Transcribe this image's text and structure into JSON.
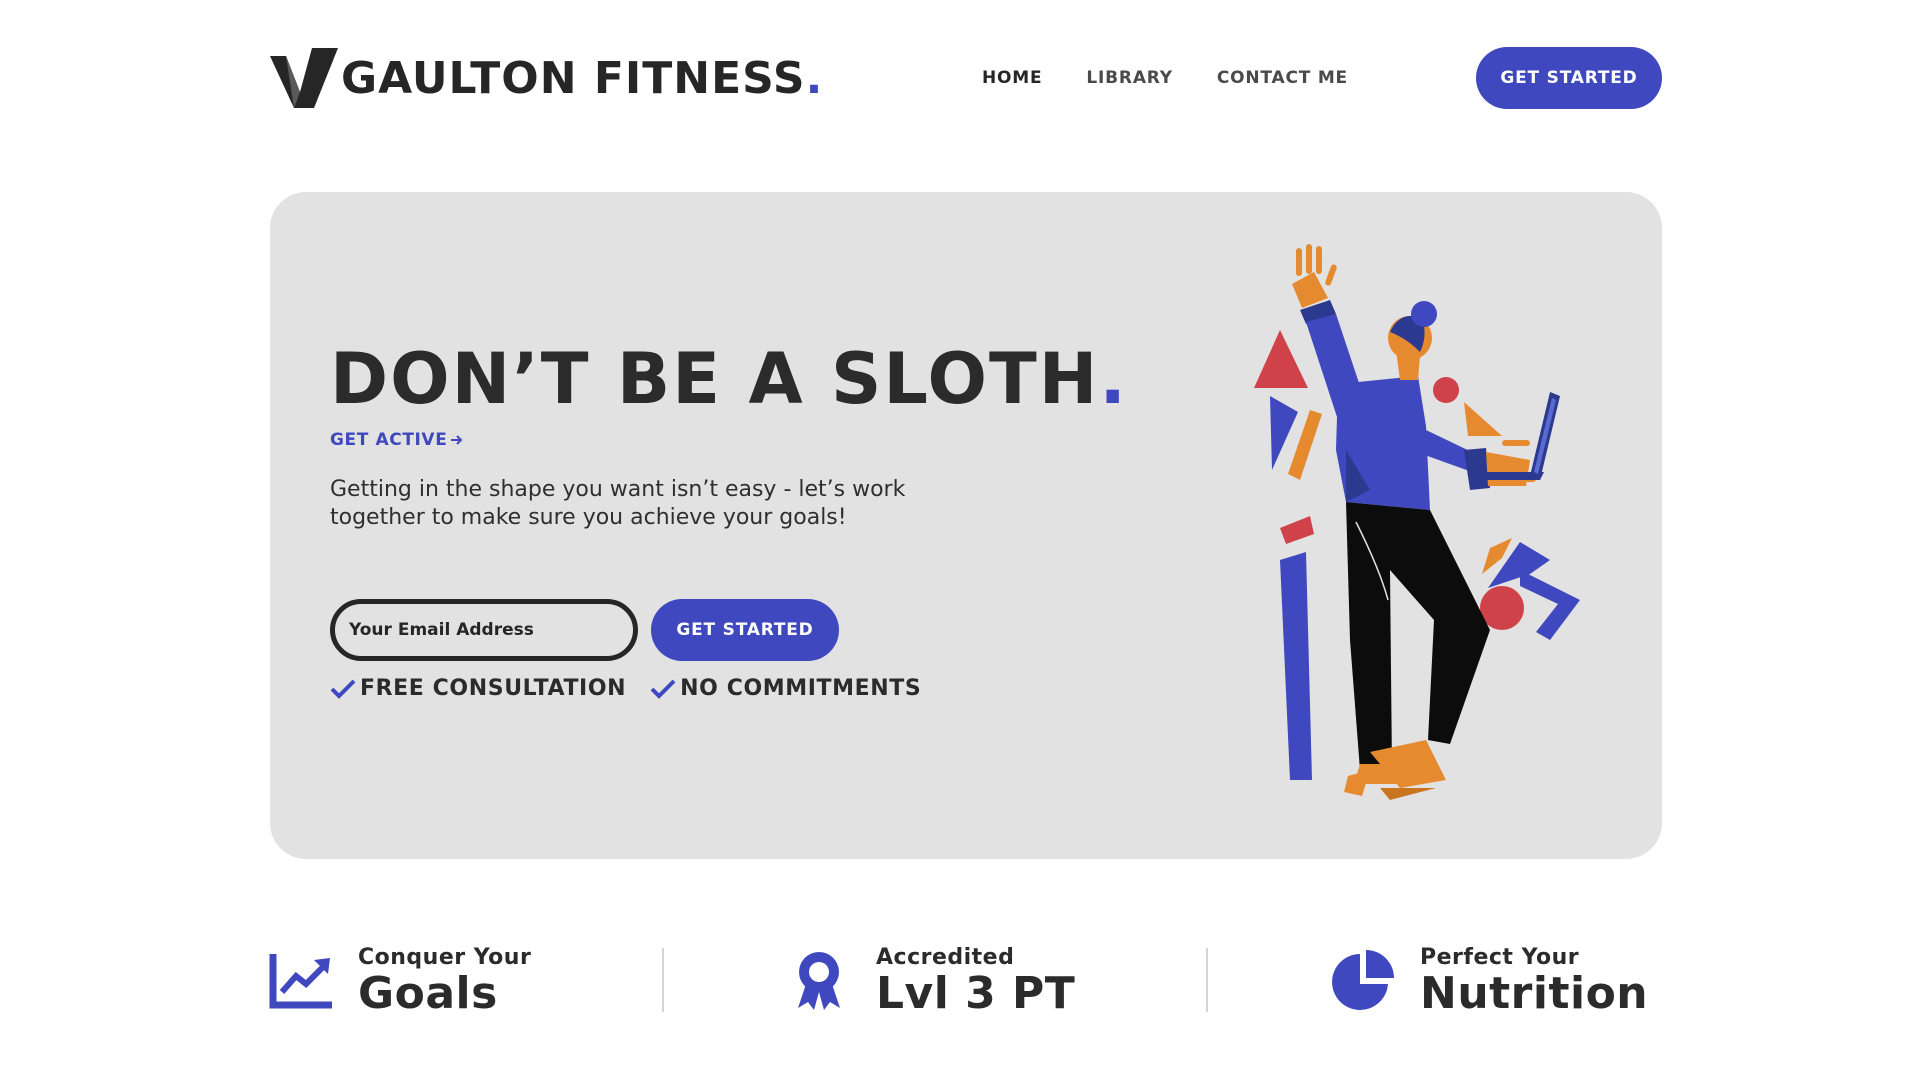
{
  "brand": {
    "name": "GAULTON FITNESS",
    "dot": ".",
    "accent_color": "#3f48bf",
    "logo_icon": "v-logo-icon"
  },
  "nav": {
    "items": [
      {
        "label": "HOME",
        "active": true
      },
      {
        "label": "LIBRARY",
        "active": false
      },
      {
        "label": "CONTACT ME",
        "active": false
      }
    ],
    "cta_label": "GET STARTED"
  },
  "hero": {
    "title": "DON’T BE A SLOTH",
    "title_dot": ".",
    "sub_link": "GET ACTIVE",
    "sub_link_icon": "arrow-right-icon",
    "description": "Getting in the shape you want isn’t easy - let’s work together to make sure you achieve your goals!",
    "email_placeholder": "Your Email Address",
    "cta_label": "GET STARTED",
    "checks": [
      {
        "label": "FREE CONSULTATION",
        "icon": "check-icon"
      },
      {
        "label": "NO COMMITMENTS",
        "icon": "check-icon"
      }
    ],
    "background_color": "#e3e2e3",
    "illustration_icon": "person-with-laptop-illustration"
  },
  "features": [
    {
      "small": "Conquer Your",
      "big": "Goals",
      "icon": "trending-chart-icon"
    },
    {
      "small": "Accredited",
      "big": "Lvl 3 PT",
      "icon": "award-ribbon-icon"
    },
    {
      "small": "Perfect Your",
      "big": "Nutrition",
      "icon": "pie-chart-icon"
    }
  ]
}
